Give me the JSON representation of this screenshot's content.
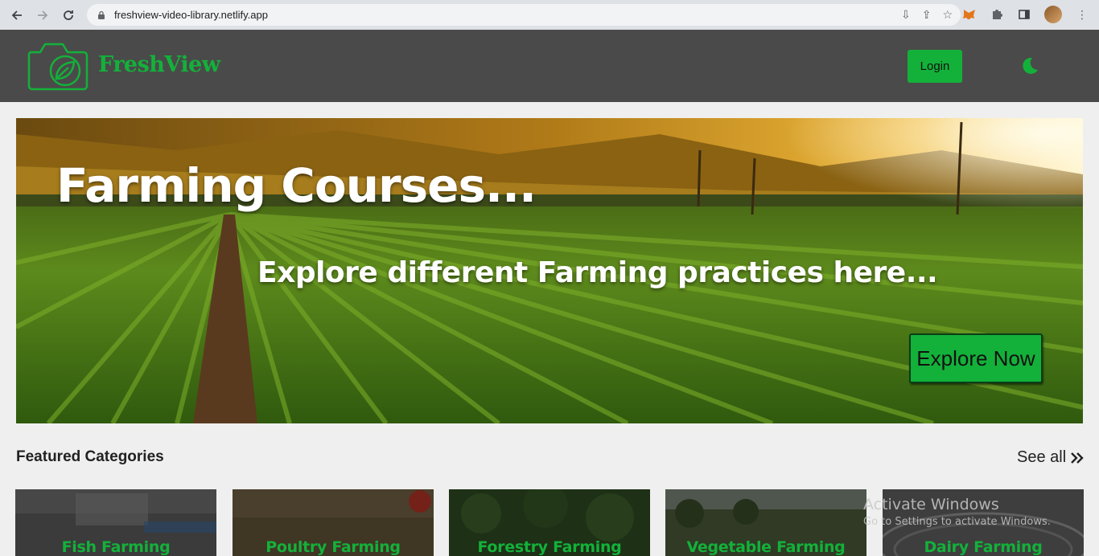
{
  "browser": {
    "url": "freshview-video-library.netlify.app"
  },
  "header": {
    "brand": "FreshView",
    "login_label": "Login"
  },
  "hero": {
    "title": "Farming Courses...",
    "subtitle": "Explore different Farming practices here...",
    "cta_label": "Explore Now"
  },
  "featured": {
    "title": "Featured Categories",
    "see_all_label": "See all",
    "categories": [
      {
        "label": "Fish Farming"
      },
      {
        "label": "Poultry Farming"
      },
      {
        "label": "Forestry Farming"
      },
      {
        "label": "Vegetable Farming"
      },
      {
        "label": "Dairy Farming"
      }
    ]
  },
  "watermark": {
    "line1": "Activate Windows",
    "line2": "Go to Settings to activate Windows."
  },
  "colors": {
    "accent": "#13b13a",
    "header_bg": "#4a4a4a",
    "page_bg": "#efefef"
  }
}
